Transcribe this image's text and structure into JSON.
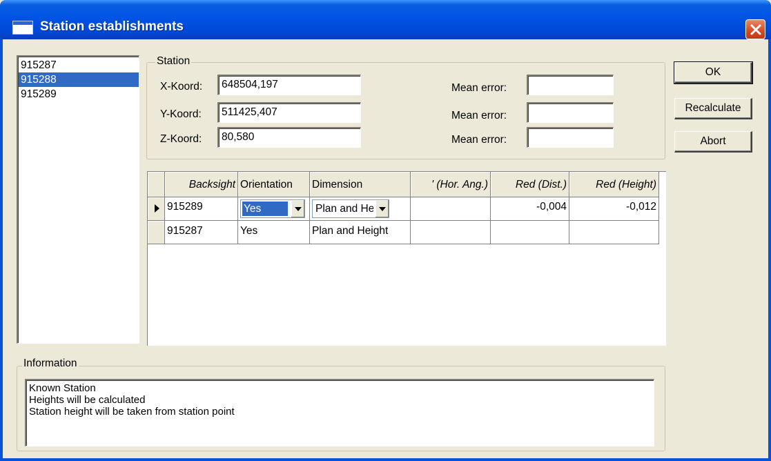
{
  "window": {
    "title": "Station establishments"
  },
  "stations": {
    "items": [
      "915287",
      "915288",
      "915289"
    ],
    "selected_index": 1
  },
  "station_group": {
    "label": "Station",
    "rows": [
      {
        "label": "X-Koord:",
        "value": "648504,197",
        "error_label": "Mean error:",
        "error_value": ""
      },
      {
        "label": "Y-Koord:",
        "value": "511425,407",
        "error_label": "Mean error:",
        "error_value": ""
      },
      {
        "label": "Z-Koord:",
        "value": "80,580",
        "error_label": "Mean error:",
        "error_value": ""
      }
    ]
  },
  "grid": {
    "headers": [
      "Backsight",
      "Orientation",
      "Dimension",
      "' (Hor. Ang.)",
      "Red (Dist.)",
      "Red (Height)"
    ],
    "rows": [
      {
        "backsight": "915289",
        "orientation": "Yes",
        "dimension": "Plan and He",
        "hor_ang": "",
        "red_dist": "-0,004",
        "red_height": "-0,012",
        "current": true
      },
      {
        "backsight": "915287",
        "orientation": "Yes",
        "dimension": "Plan and Height",
        "hor_ang": "",
        "red_dist": "",
        "red_height": "",
        "current": false
      }
    ]
  },
  "buttons": {
    "ok": "OK",
    "recalculate": "Recalculate",
    "abort": "Abort"
  },
  "info": {
    "label": "Information",
    "lines": [
      "Known Station",
      "Heights will be calculated",
      "Station height will be taken from station point"
    ]
  },
  "icons": {
    "window": "window-icon",
    "close": "close-icon",
    "row_pointer": "row-pointer-icon",
    "dropdown": "chevron-down-icon"
  },
  "colors": {
    "titlebar": "#0055e5",
    "selection": "#316ac5",
    "close": "#d44a22",
    "background": "#ece9d8"
  }
}
